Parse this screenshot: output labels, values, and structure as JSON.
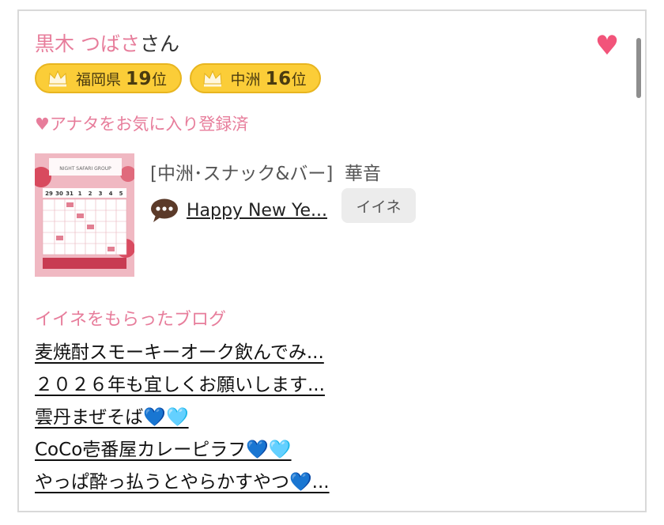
{
  "user": {
    "name": "黒木 つばさ",
    "honorific": "さん",
    "favorite_icon": "heart-icon"
  },
  "badges": [
    {
      "icon": "crown-icon",
      "area": "福岡県",
      "rank": "19",
      "suffix": "位"
    },
    {
      "icon": "crown-icon",
      "area": "中洲",
      "rank": "16",
      "suffix": "位"
    }
  ],
  "favorite_status": "♥アナタをお気に入り登録済",
  "latest_blog": {
    "shop": "[中洲･スナック&バー]",
    "author": "華音",
    "title": "Happy New Ye...",
    "like_label": "イイネ",
    "thumbnail": {
      "header": "NIGHT SAFARI GROUP",
      "dates": [
        "29",
        "30",
        "31",
        "1",
        "2",
        "3",
        "4",
        "5"
      ]
    }
  },
  "liked_blogs": {
    "heading": "イイネをもらったブログ",
    "items": [
      "麦焼酎スモーキーオーク飲んでみ...",
      "２０２６年も宜しくお願いします...",
      "雲丹まぜそば💙🩵",
      "CoCo壱番屋カレーピラフ💙🩵",
      "やっぱ酔っ払うとやらかすやつ💙..."
    ]
  },
  "colors": {
    "pink": "#e77d9b",
    "heart": "#f2547a",
    "badge": "#fbcd38",
    "badge_border": "#e8b51f"
  }
}
